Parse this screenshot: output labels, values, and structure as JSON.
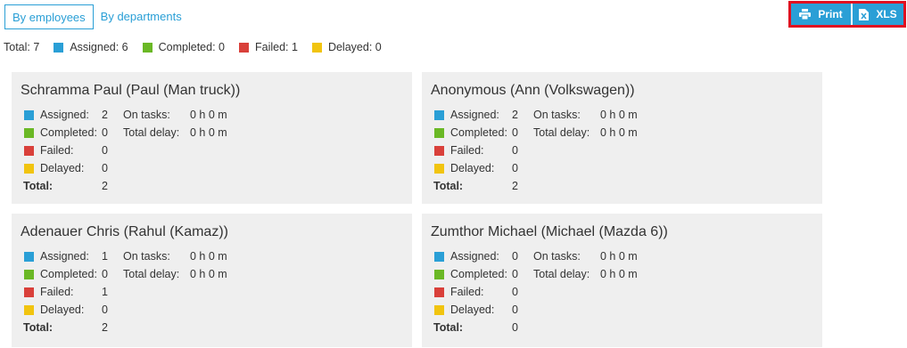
{
  "tabs": [
    {
      "label": "By employees",
      "active": true
    },
    {
      "label": "By departments",
      "active": false
    }
  ],
  "actions": {
    "print_label": "Print",
    "xls_label": "XLS"
  },
  "colors": {
    "assigned": "#2a9fd6",
    "completed": "#6ab825",
    "failed": "#d9403a",
    "delayed": "#f1c40f",
    "card_bg": "#efefef",
    "highlight": "#e01020"
  },
  "summary": {
    "total": "Total: 7",
    "assigned": "Assigned: 6",
    "completed": "Completed: 0",
    "failed": "Failed: 1",
    "delayed": "Delayed: 0"
  },
  "labels": {
    "assigned": "Assigned:",
    "completed": "Completed:",
    "failed": "Failed:",
    "delayed": "Delayed:",
    "total": "Total:",
    "on_tasks": "On tasks:",
    "total_delay": "Total delay:"
  },
  "cards": [
    {
      "name": "Schramma Paul (Paul (Man truck))",
      "assigned": "2",
      "completed": "0",
      "failed": "0",
      "delayed": "0",
      "total": "2",
      "on_tasks": "0 h 0 m",
      "total_delay": "0 h 0 m"
    },
    {
      "name": "Anonymous (Ann (Volkswagen))",
      "assigned": "2",
      "completed": "0",
      "failed": "0",
      "delayed": "0",
      "total": "2",
      "on_tasks": "0 h 0 m",
      "total_delay": "0 h 0 m"
    },
    {
      "name": "Adenauer Chris (Rahul (Kamaz))",
      "assigned": "1",
      "completed": "0",
      "failed": "1",
      "delayed": "0",
      "total": "2",
      "on_tasks": "0 h 0 m",
      "total_delay": "0 h 0 m"
    },
    {
      "name": "Zumthor Michael (Michael (Mazda 6))",
      "assigned": "0",
      "completed": "0",
      "failed": "0",
      "delayed": "0",
      "total": "0",
      "on_tasks": "0 h 0 m",
      "total_delay": "0 h 0 m"
    }
  ]
}
